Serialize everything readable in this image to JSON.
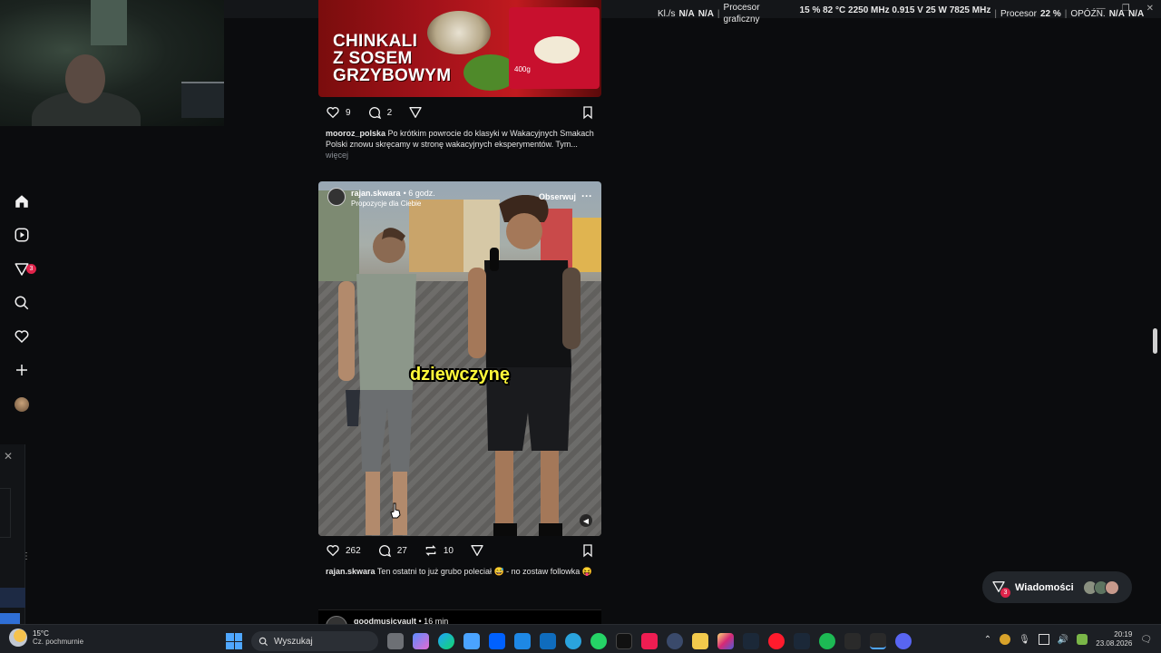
{
  "overlay": {
    "kl_label": "Kl./s",
    "kl_val1": "N/A",
    "kl_val2": "N/A",
    "gpu_label_1": "Procesor",
    "gpu_label_2": "graficzny",
    "gpu_stats": "15 %  82 °C  2250 MHz  0.915 V  25 W  7825 MHz",
    "cpu_label": "Procesor",
    "cpu_val": "22 %",
    "lat_label": "OPÓŹN.",
    "lat_val1": "N/A",
    "lat_val2": "N/A"
  },
  "sidebar": {
    "messages_badge": "3"
  },
  "post1": {
    "title_line1": "CHINKALI",
    "title_line2": "Z SOSEM",
    "title_line3": "GRZYBOWYM",
    "pack_weight": "400g",
    "likes": "9",
    "comments": "2",
    "caption_user": "mooroz_polska",
    "caption_text": "Po krótkim powrocie do klasyki w Wakacyjnych Smakach Polski znowu skręcamy w stronę wakacyjnych eksperymentów. Tym...",
    "caption_more": "więcej"
  },
  "post2": {
    "username": "rajan.skwara",
    "time": "• 6 godz.",
    "suggested": "Propozycje dla Ciebie",
    "follow": "Obserwuj",
    "subtitle": "dziewczynę",
    "likes": "262",
    "comments": "27",
    "reposts": "10",
    "caption_user": "rajan.skwara",
    "caption_text": "Ten ostatni to już grubo poleciał 😅 - no zostaw followka 😝"
  },
  "post3": {
    "username": "goodmusicvault",
    "time": "• 16 min"
  },
  "messages": {
    "label": "Wiadomości",
    "badge": "3"
  },
  "taskbar": {
    "temp": "15°C",
    "weather": "Cz. pochmurnie",
    "search_placeholder": "Wyszukaj",
    "time": "20:19",
    "date": "23.08.2026"
  }
}
